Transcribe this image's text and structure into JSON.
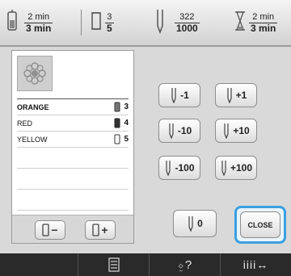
{
  "status_bar": {
    "time_elapsed": "2 min",
    "time_total": "3 min",
    "color_current": "3",
    "color_total": "5",
    "stitch_current": "322",
    "stitch_total": "1000",
    "remaining_time": "2 min",
    "remaining_total": "3 min"
  },
  "color_list": {
    "items": [
      {
        "name": "ORANGE",
        "number": "3",
        "spool_color": "#777777"
      },
      {
        "name": "RED",
        "number": "4",
        "spool_color": "#333333"
      },
      {
        "name": "YELLOW",
        "number": "5",
        "spool_color": "#ffffff"
      }
    ]
  },
  "needle_buttons": {
    "minus_1": "-1",
    "plus_1": "+1",
    "minus_10": "-10",
    "plus_10": "+10",
    "minus_100": "-100",
    "plus_100": "+100",
    "zero": "0"
  },
  "close_label": "CLOSE",
  "colors": {
    "highlight": "#3aa0e0",
    "bottom_bar": "#2a2a2a"
  },
  "bottom_bar": {
    "icons": [
      "list-icon",
      "help-icon",
      "frame-move-icon"
    ]
  }
}
